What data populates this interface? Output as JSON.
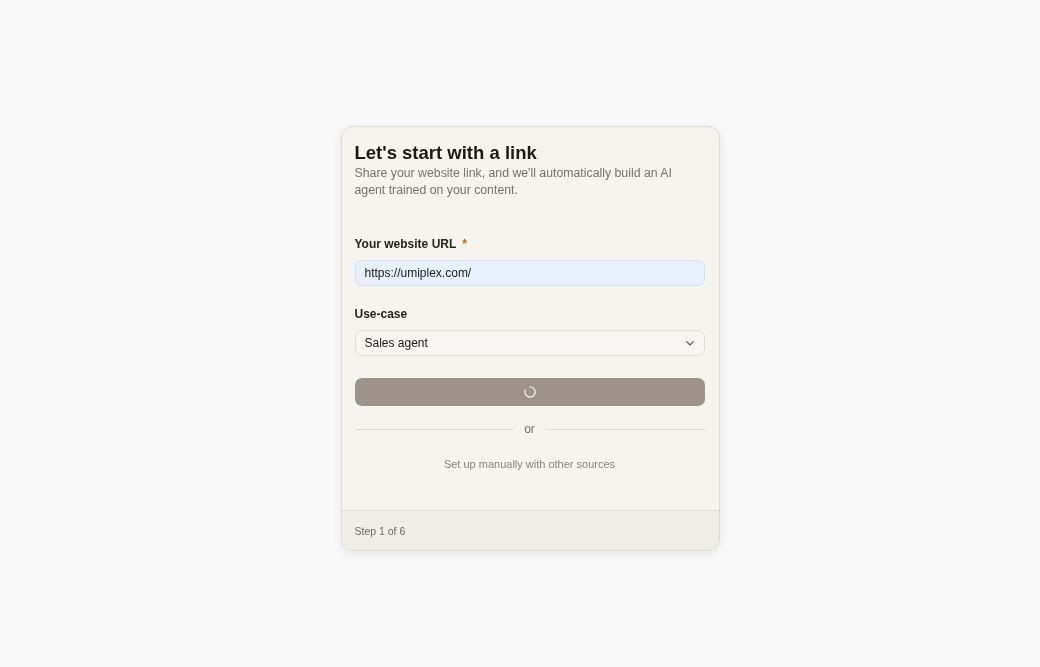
{
  "card": {
    "title": "Let's start with a link",
    "subtitle": "Share your website link, and we'll automatically build an AI agent trained on your content.",
    "fields": [
      {
        "kind": "text",
        "label": "Your website URL",
        "required_mark": "*",
        "value": "https://umiplex.com/",
        "autofilled": true
      },
      {
        "kind": "select",
        "label": "Use-case",
        "value": "Sales agent"
      }
    ],
    "submit_button": {
      "loading": true,
      "disabled": true
    },
    "divider": {
      "label": "or"
    },
    "manual_link": "Set up manually with other sources",
    "footer": {
      "step": "Step 1 of 6"
    }
  }
}
